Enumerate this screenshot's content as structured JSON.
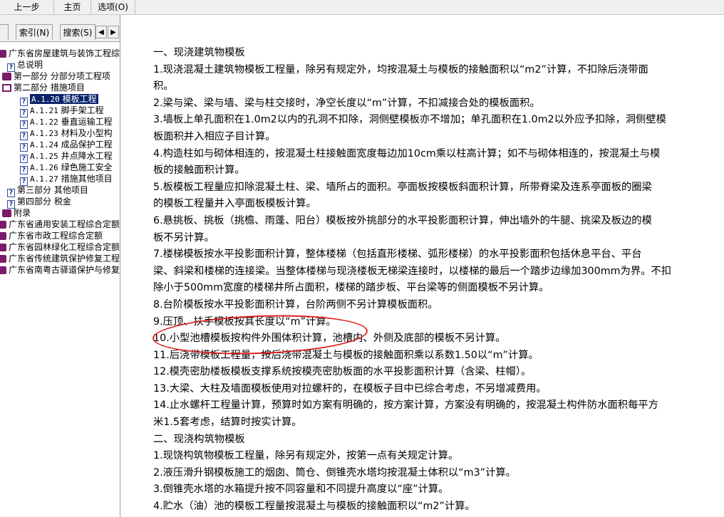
{
  "menubar": {
    "back": "上一步",
    "home": "主页",
    "options": "选项(O)"
  },
  "tabs": {
    "index": "索引(N)",
    "search": "搜索(S)",
    "prev": "◀",
    "next": "▶"
  },
  "tree": [
    {
      "label": "广东省房屋建筑与装饰工程综",
      "icon": "book-icon"
    },
    {
      "label": "总说明",
      "icon": "help-page-icon"
    },
    {
      "label": "第一部分  分部分项工程项",
      "icon": "book-icon"
    },
    {
      "label": "第二部分  措施项目",
      "icon": "book-open-icon"
    },
    {
      "code": "A.1.20",
      "label": "模板工程",
      "icon": "help-page-icon",
      "selected": true
    },
    {
      "code": "A.1.21",
      "label": "脚手架工程",
      "icon": "help-page-icon"
    },
    {
      "code": "A.1.22",
      "label": "垂直运输工程",
      "icon": "help-page-icon"
    },
    {
      "code": "A.1.23",
      "label": "材料及小型构",
      "icon": "help-page-icon"
    },
    {
      "code": "A.1.24",
      "label": "成品保护工程",
      "icon": "help-page-icon"
    },
    {
      "code": "A.1.25",
      "label": "井点降水工程",
      "icon": "help-page-icon"
    },
    {
      "code": "A.1.26",
      "label": "绿色施工安全",
      "icon": "help-page-icon"
    },
    {
      "code": "A.1.27",
      "label": "措施其他项目",
      "icon": "help-page-icon"
    },
    {
      "label": "第三部分  其他项目",
      "icon": "help-page-icon"
    },
    {
      "label": "第四部分  税金",
      "icon": "help-page-icon"
    },
    {
      "label": "附录",
      "icon": "book-icon"
    },
    {
      "label": "广东省通用安装工程综合定额",
      "icon": "book-icon"
    },
    {
      "label": "广东省市政工程综合定额",
      "icon": "book-icon"
    },
    {
      "label": "广东省园林绿化工程综合定额",
      "icon": "book-icon"
    },
    {
      "label": "广东省传统建筑保护修复工程",
      "icon": "book-icon"
    },
    {
      "label": "广东省南粤古驿道保护与修复",
      "icon": "book-icon"
    }
  ],
  "content": [
    "一、现浇建筑物模板",
    "1.现浇混凝土建筑物模板工程量，除另有规定外，均按混凝土与模板的接触面积以“m2”计算，不扣除后浇带面",
    "积。",
    "2.梁与梁、梁与墙、梁与柱交接时，净空长度以“m”计算，不扣减接合处的模板面积。",
    "3.墙板上单孔面积在1.0m2以内的孔洞不扣除，洞侧壁模板亦不增加；单孔面积在1.0m2以外应予扣除，洞侧壁模",
    "板面积并入相应子目计算。",
    "4.构造柱如与砌体相连的，按混凝土柱接触面宽度每边加10cm乘以柱高计算；如不与砌体相连的，按混凝土与模",
    "板的接触面积计算。",
    "5.板模板工程量应扣除混凝土柱、梁、墙所占的面积。亭面板按模板斜面积计算，所带脊梁及连系亭面板的圈梁",
    "的模板工程量并入亭面板模板计算。",
    "6.悬挑板、挑板（挑檐、雨蓬、阳台）模板按外挑部分的水平投影面积计算，伸出墙外的牛腿、挑梁及板边的模",
    "板不另计算。",
    "7.楼梯模板按水平投影面积计算，整体楼梯（包括直形楼梯、弧形楼梯）的水平投影面积包括休息平台、平台",
    "梁、斜梁和楼梯的连接梁。当整体楼梯与现浇楼板无梯梁连接时，以楼梯的最后一个踏步边缘加300mm为界。不扣",
    "除小于500mm宽度的楼梯井所占面积，楼梯的踏步板、平台梁等的侧面模板不另计算。",
    "8.台阶模板按水平投影面积计算，台阶两侧不另计算模板面积。",
    "9.压顶、扶手模板按其长度以“m”计算。",
    "10.小型池槽模板按构件外围体积计算，池槽内、外侧及底部的模板不另计算。",
    "11.后浇带模板工程量，按后浇带混凝土与模板的接触面积乘以系数1.50以“m”计算。",
    "12.模壳密肋楼板模板支撑系统按模壳密肋板面的水平投影面积计算（含梁、柱帽）。",
    "13.大梁、大柱及墙面模板使用对拉螺杆的，在模板子目中已综合考虑，不另增减费用。",
    "14.止水螺杆工程量计算，预算时如方案有明确的，按方案计算，方案没有明确的，按混凝土构件防水面积每平方",
    "米1.5套考虑，结算时按实计算。",
    "二、现浇构筑物模板",
    "1.现饶构筑物模板工程量，除另有规定外，按第一点有关规定计算。",
    "2.液压滑升钢模板施工的烟囱、筒仓、倒锥壳水塔均按混凝土体积以“m3”计算。",
    "3.倒锥壳水塔的水箱提升按不同容量和不同提升高度以“座”计算。",
    "4.贮水（油）池的模板工程量按混凝土与模板的接触面积以“m2”计算。"
  ],
  "highlight_color": "#e02020"
}
